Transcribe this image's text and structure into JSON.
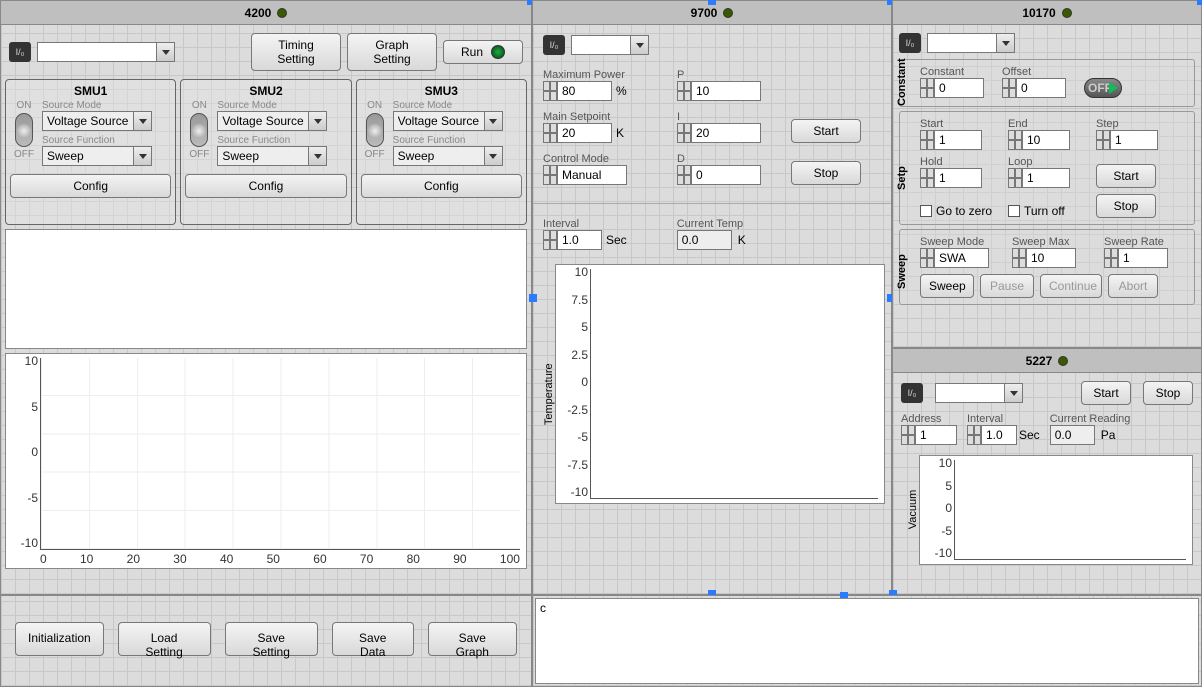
{
  "p4200": {
    "title": "4200",
    "buttons": {
      "timing": "Timing Setting",
      "graph": "Graph Setting",
      "run": "Run"
    },
    "smus": [
      {
        "name": "SMU1",
        "source_mode": "Voltage Source",
        "source_function": "Sweep",
        "config": "Config",
        "on": "ON",
        "off": "OFF",
        "lbl_mode": "Source Mode",
        "lbl_func": "Source Function"
      },
      {
        "name": "SMU2",
        "source_mode": "Voltage Source",
        "source_function": "Sweep",
        "config": "Config",
        "on": "ON",
        "off": "OFF",
        "lbl_mode": "Source Mode",
        "lbl_func": "Source Function"
      },
      {
        "name": "SMU3",
        "source_mode": "Voltage Source",
        "source_function": "Sweep",
        "config": "Config",
        "on": "ON",
        "off": "OFF",
        "lbl_mode": "Source Mode",
        "lbl_func": "Source Function"
      }
    ],
    "chart": {
      "y": [
        "10",
        "5",
        "0",
        "-5",
        "-10"
      ],
      "x": [
        "0",
        "10",
        "20",
        "30",
        "40",
        "50",
        "60",
        "70",
        "80",
        "90",
        "100"
      ]
    }
  },
  "p9700": {
    "title": "9700",
    "lbl_maxpow": "Maximum Power",
    "maxpow": "80",
    "maxpow_u": "%",
    "lbl_setp": "Main Setpoint",
    "setp": "20",
    "setp_u": "K",
    "lbl_ctrl": "Control Mode",
    "ctrl": "Manual",
    "lbl_p": "P",
    "p": "10",
    "lbl_i": "I",
    "i": "20",
    "lbl_d": "D",
    "d": "0",
    "start": "Start",
    "stop": "Stop",
    "lbl_int": "Interval",
    "int": "1.0",
    "int_u": "Sec",
    "lbl_ct": "Current Temp",
    "ct": "0.0",
    "ct_u": "K",
    "chart_label": "Temperature",
    "chart": {
      "y": [
        "10",
        "7.5",
        "5",
        "2.5",
        "0",
        "-2.5",
        "-5",
        "-7.5",
        "-10"
      ]
    }
  },
  "p10170": {
    "title": "10170",
    "tab_const": "Constant",
    "tab_setp": "Setp",
    "tab_sweep": "Sweep",
    "lbl_const": "Constant",
    "const": "0",
    "lbl_off": "Offset",
    "off": "0",
    "switch": "OFF",
    "lbl_start": "Start",
    "start": "1",
    "lbl_end": "End",
    "end": "10",
    "lbl_step": "Step",
    "step": "1",
    "lbl_hold": "Hold",
    "hold": "1",
    "lbl_loop": "Loop",
    "loop": "1",
    "btn_start": "Start",
    "btn_stop": "Stop",
    "chk_zero": "Go to zero",
    "chk_turnoff": "Turn off",
    "lbl_smode": "Sweep Mode",
    "smode": "SWA",
    "lbl_smax": "Sweep Max",
    "smax": "10",
    "lbl_srate": "Sweep Rate",
    "srate": "1",
    "btn_sweep": "Sweep",
    "btn_pause": "Pause",
    "btn_cont": "Continue",
    "btn_abort": "Abort"
  },
  "p5227": {
    "title": "5227",
    "start": "Start",
    "stop": "Stop",
    "lbl_addr": "Address",
    "addr": "1",
    "lbl_int": "Interval",
    "int": "1.0",
    "int_u": "Sec",
    "lbl_cr": "Current Reading",
    "cr": "0.0",
    "cr_u": "Pa",
    "chart_label": "Vacuum",
    "chart": {
      "y": [
        "10",
        "5",
        "0",
        "-5",
        "-10"
      ]
    }
  },
  "bottom": {
    "init": "Initialization",
    "load": "Load Setting",
    "save": "Save Setting",
    "savedata": "Save Data",
    "savegraph": "Save Graph"
  },
  "log": "c",
  "io": "I/₀"
}
